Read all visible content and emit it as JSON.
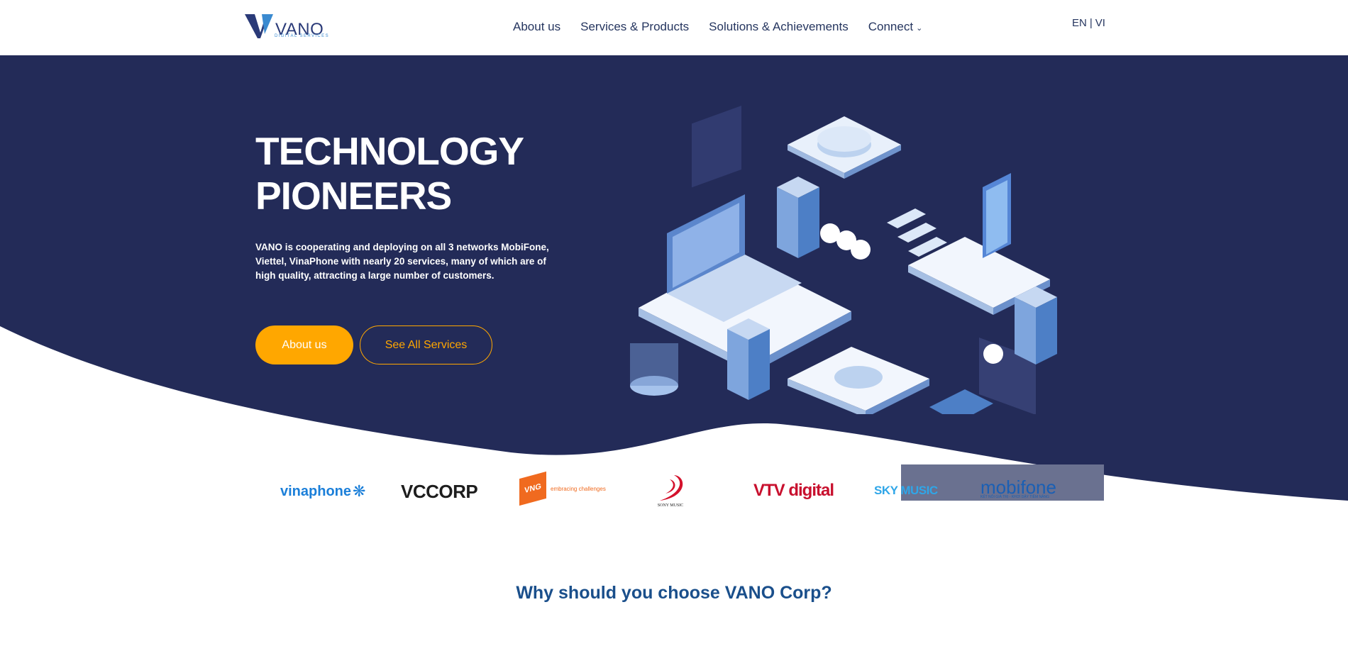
{
  "header": {
    "logo_text": "VANO",
    "logo_sub": "DIGITAL SERVICES",
    "nav": [
      {
        "label": "About us"
      },
      {
        "label": "Services & Products"
      },
      {
        "label": "Solutions & Achievements"
      },
      {
        "label": "Connect"
      }
    ],
    "lang": {
      "en": "EN",
      "sep": "|",
      "vi": "VI"
    }
  },
  "hero": {
    "title_line1": "TECHNOLOGY",
    "title_line2": "PIONEERS",
    "description": "VANO is cooperating and deploying on all 3 networks MobiFone, Viettel, VinaPhone with nearly 20 services, many of which are of high quality, attracting a large number of customers.",
    "btn_primary": "About us",
    "btn_secondary": "See All Services"
  },
  "partners": [
    {
      "name": "vinaphone"
    },
    {
      "name": "VCCORP"
    },
    {
      "name": "VNG",
      "tagline": "embracing challenges"
    },
    {
      "name": "SONY MUSIC"
    },
    {
      "name": "VTV digital"
    },
    {
      "name": "SKY MUSIC"
    },
    {
      "name": "mobifone",
      "tagline": "KẾT NỐI GIÁ TRỊ - KHƠI DẬY TIỀM NĂNG"
    }
  ],
  "section": {
    "title": "Why should you choose VANO Corp?"
  },
  "colors": {
    "navy": "#232b58",
    "accent": "#ffa700",
    "title_blue": "#1a4f8b"
  }
}
